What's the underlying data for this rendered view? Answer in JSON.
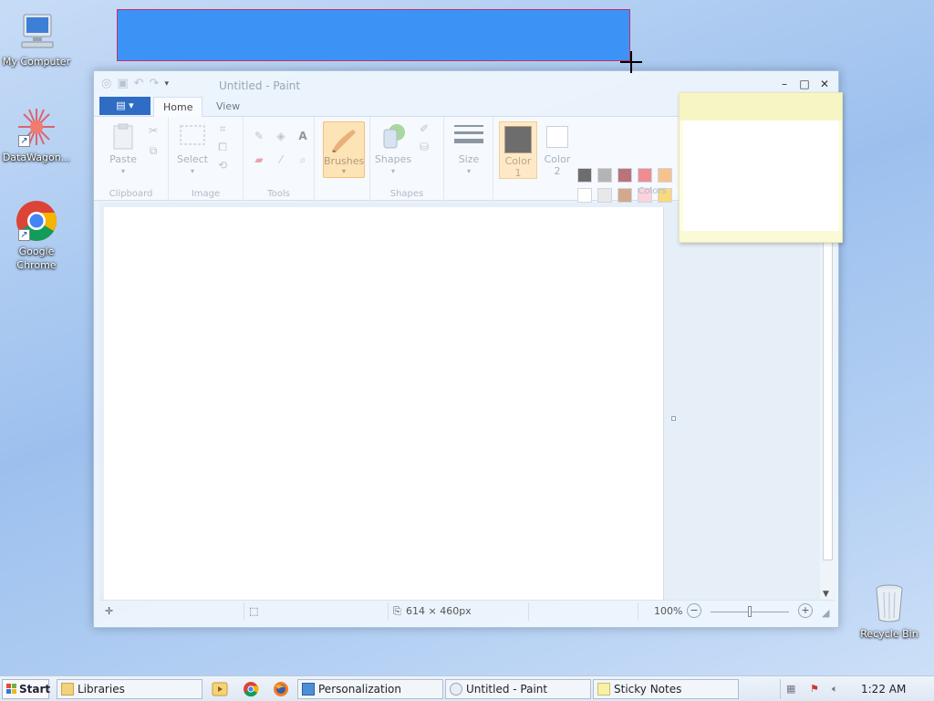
{
  "desktop": {
    "icons": [
      {
        "label": "My Computer"
      },
      {
        "label": "DataWagon..."
      },
      {
        "label": "Google\nChrome"
      },
      {
        "label": "Recycle Bin"
      }
    ]
  },
  "paint": {
    "title": "Untitled - Paint",
    "tabs": {
      "home": "Home",
      "view": "View"
    },
    "groups": {
      "clipboard": "Clipboard",
      "image": "Image",
      "tools": "Tools",
      "shapes": "Shapes",
      "colors": "Colors"
    },
    "buttons": {
      "paste": "Paste",
      "select": "Select",
      "brushes": "Brushes",
      "shapes": "Shapes",
      "size": "Size",
      "color1": "Color\n1",
      "color2": "Color\n2"
    },
    "palette": [
      "#6d6d6d",
      "#b4b4b4",
      "#b9737b",
      "#ee8d8f",
      "#f7c28e",
      "#ffffff",
      "#e8e8e8",
      "#d2a98d",
      "#fbd2dc",
      "#f9d97e"
    ],
    "color1_value": "#6d6d6d",
    "status": {
      "image_size": "614 × 460px",
      "zoom": "100%"
    }
  },
  "taskbar": {
    "start": "Start",
    "buttons": {
      "libraries": "Libraries",
      "personalization": "Personalization",
      "paint": "Untitled - Paint",
      "sticky": "Sticky Notes"
    },
    "clock": "1:22 AM"
  }
}
